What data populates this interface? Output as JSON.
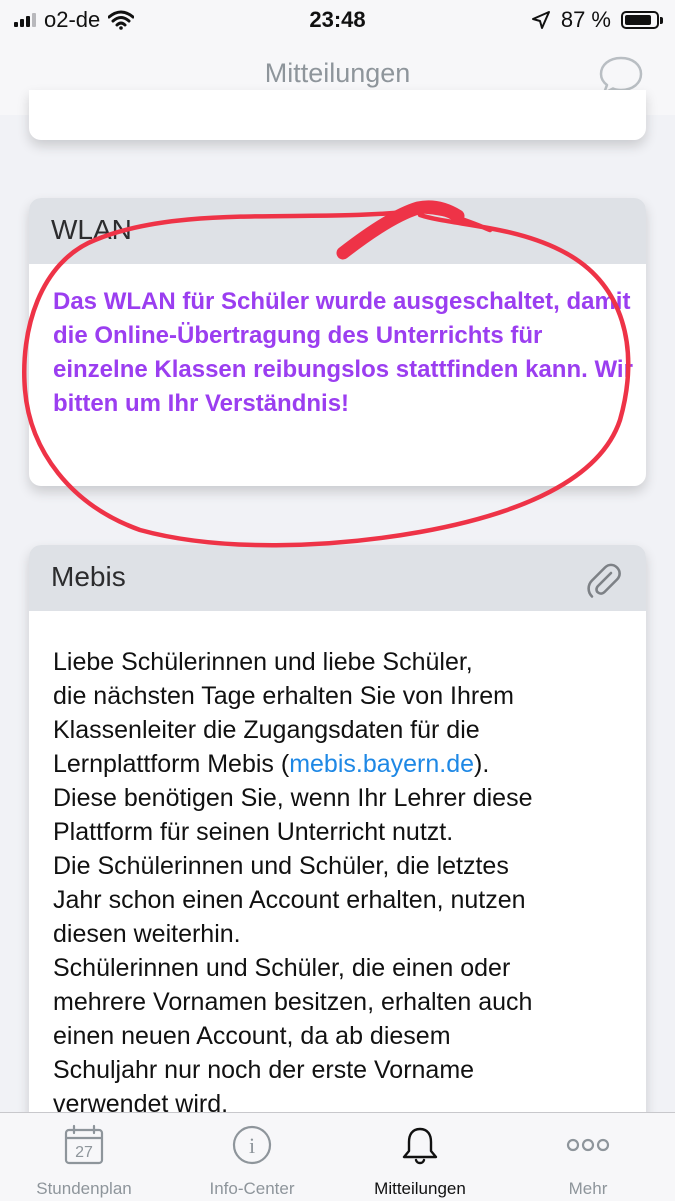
{
  "status_bar": {
    "carrier": "o2-de",
    "time": "23:48",
    "battery_percent": "87 %",
    "battery_level": 0.87
  },
  "nav": {
    "title": "Mitteilungen",
    "chat_icon": "chat-bubble-icon"
  },
  "cards": [
    {
      "title": "WLAN",
      "body": "Das WLAN für Schüler wurde ausgeschaltet, damit die Online-Übertragung des Unterrichts für einzelne Klassen reibungslos stattfinden kann. Wir bitten um Ihr Verständnis!",
      "body_color": "#9b3ef0"
    },
    {
      "title": "Mebis",
      "attachment_icon": "paperclip-icon",
      "body_lines": [
        "Liebe Schülerinnen und liebe Schüler,",
        "die nächsten Tage erhalten Sie von Ihrem",
        "Klassenleiter die Zugangsdaten für die"
      ],
      "link_line": {
        "before": "Lernplattform Mebis (",
        "link": "mebis.bayern.de",
        "after": ")."
      },
      "body_lines_2": [
        "Diese benötigen Sie, wenn Ihr Lehrer diese",
        "Plattform für seinen Unterricht nutzt.",
        "Die Schülerinnen und Schüler, die letztes",
        "Jahr schon einen Account erhalten, nutzen",
        "diesen weiterhin.",
        "Schülerinnen und Schüler, die einen oder",
        "mehrere Vornamen besitzen, erhalten auch",
        "einen neuen Account, da ab diesem",
        "Schuljahr nur noch der erste Vorname",
        "verwendet wird."
      ]
    }
  ],
  "tabs": [
    {
      "label": "Stundenplan",
      "icon": "calendar-icon",
      "icon_text": "27",
      "active": false
    },
    {
      "label": "Info-Center",
      "icon": "info-icon",
      "icon_text": "i",
      "active": false
    },
    {
      "label": "Mitteilungen",
      "icon": "bell-icon",
      "active": true
    },
    {
      "label": "Mehr",
      "icon": "more-dots-icon",
      "active": false
    }
  ],
  "colors": {
    "annotation_red": "#ee3347",
    "link_blue": "#1e88e5",
    "header_gray": "#dee1e6"
  }
}
